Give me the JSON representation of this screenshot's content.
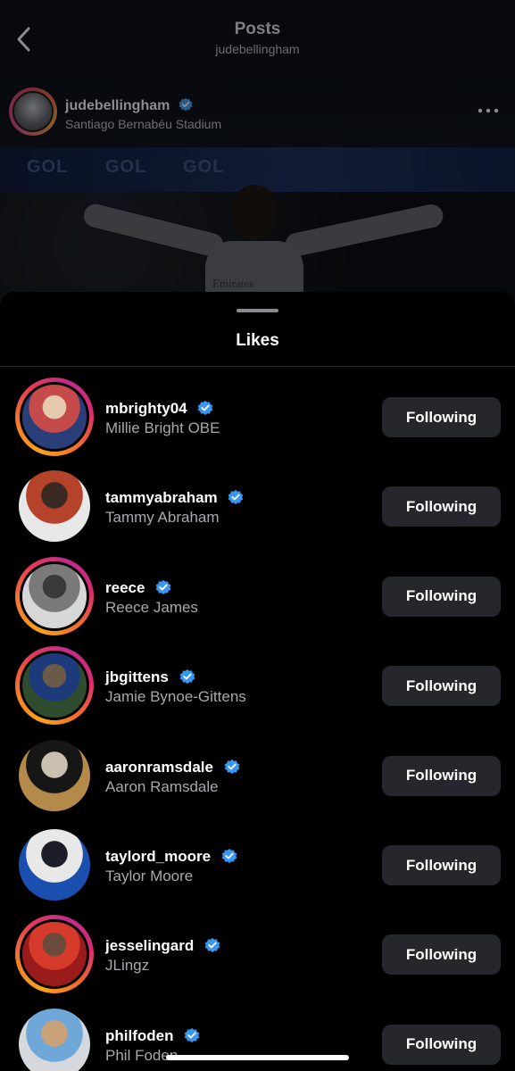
{
  "nav": {
    "title": "Posts",
    "subtitle": "judebellingham"
  },
  "post": {
    "username": "judebellingham",
    "location": "Santiago Bernabéu Stadium",
    "banner_text": [
      "GOL",
      "GOL",
      "GOL"
    ],
    "shirt_sponsor": "Emirates"
  },
  "likes": {
    "title": "Likes",
    "users": [
      {
        "username": "mbrighty04",
        "fullname": "Millie Bright OBE",
        "button": "Following",
        "story_ring": true
      },
      {
        "username": "tammyabraham",
        "fullname": "Tammy Abraham",
        "button": "Following",
        "story_ring": false
      },
      {
        "username": "reece",
        "fullname": "Reece James",
        "button": "Following",
        "story_ring": true
      },
      {
        "username": "jbgittens",
        "fullname": "Jamie Bynoe-Gittens",
        "button": "Following",
        "story_ring": true
      },
      {
        "username": "aaronramsdale",
        "fullname": "Aaron Ramsdale",
        "button": "Following",
        "story_ring": false
      },
      {
        "username": "taylord_moore",
        "fullname": "Taylor Moore",
        "button": "Following",
        "story_ring": false
      },
      {
        "username": "jesselingard",
        "fullname": "JLingz",
        "button": "Following",
        "story_ring": true
      },
      {
        "username": "philfoden",
        "fullname": "Phil Foden",
        "button": "Following",
        "story_ring": false
      }
    ]
  },
  "icons": {
    "back": "chevron-left-icon",
    "more": "more-horizontal-icon",
    "verified": "verified-badge-icon"
  },
  "colors": {
    "verified_blue": "#3897f0",
    "button_bg": "#25272c",
    "secondary_text": "#a8a8ad"
  }
}
